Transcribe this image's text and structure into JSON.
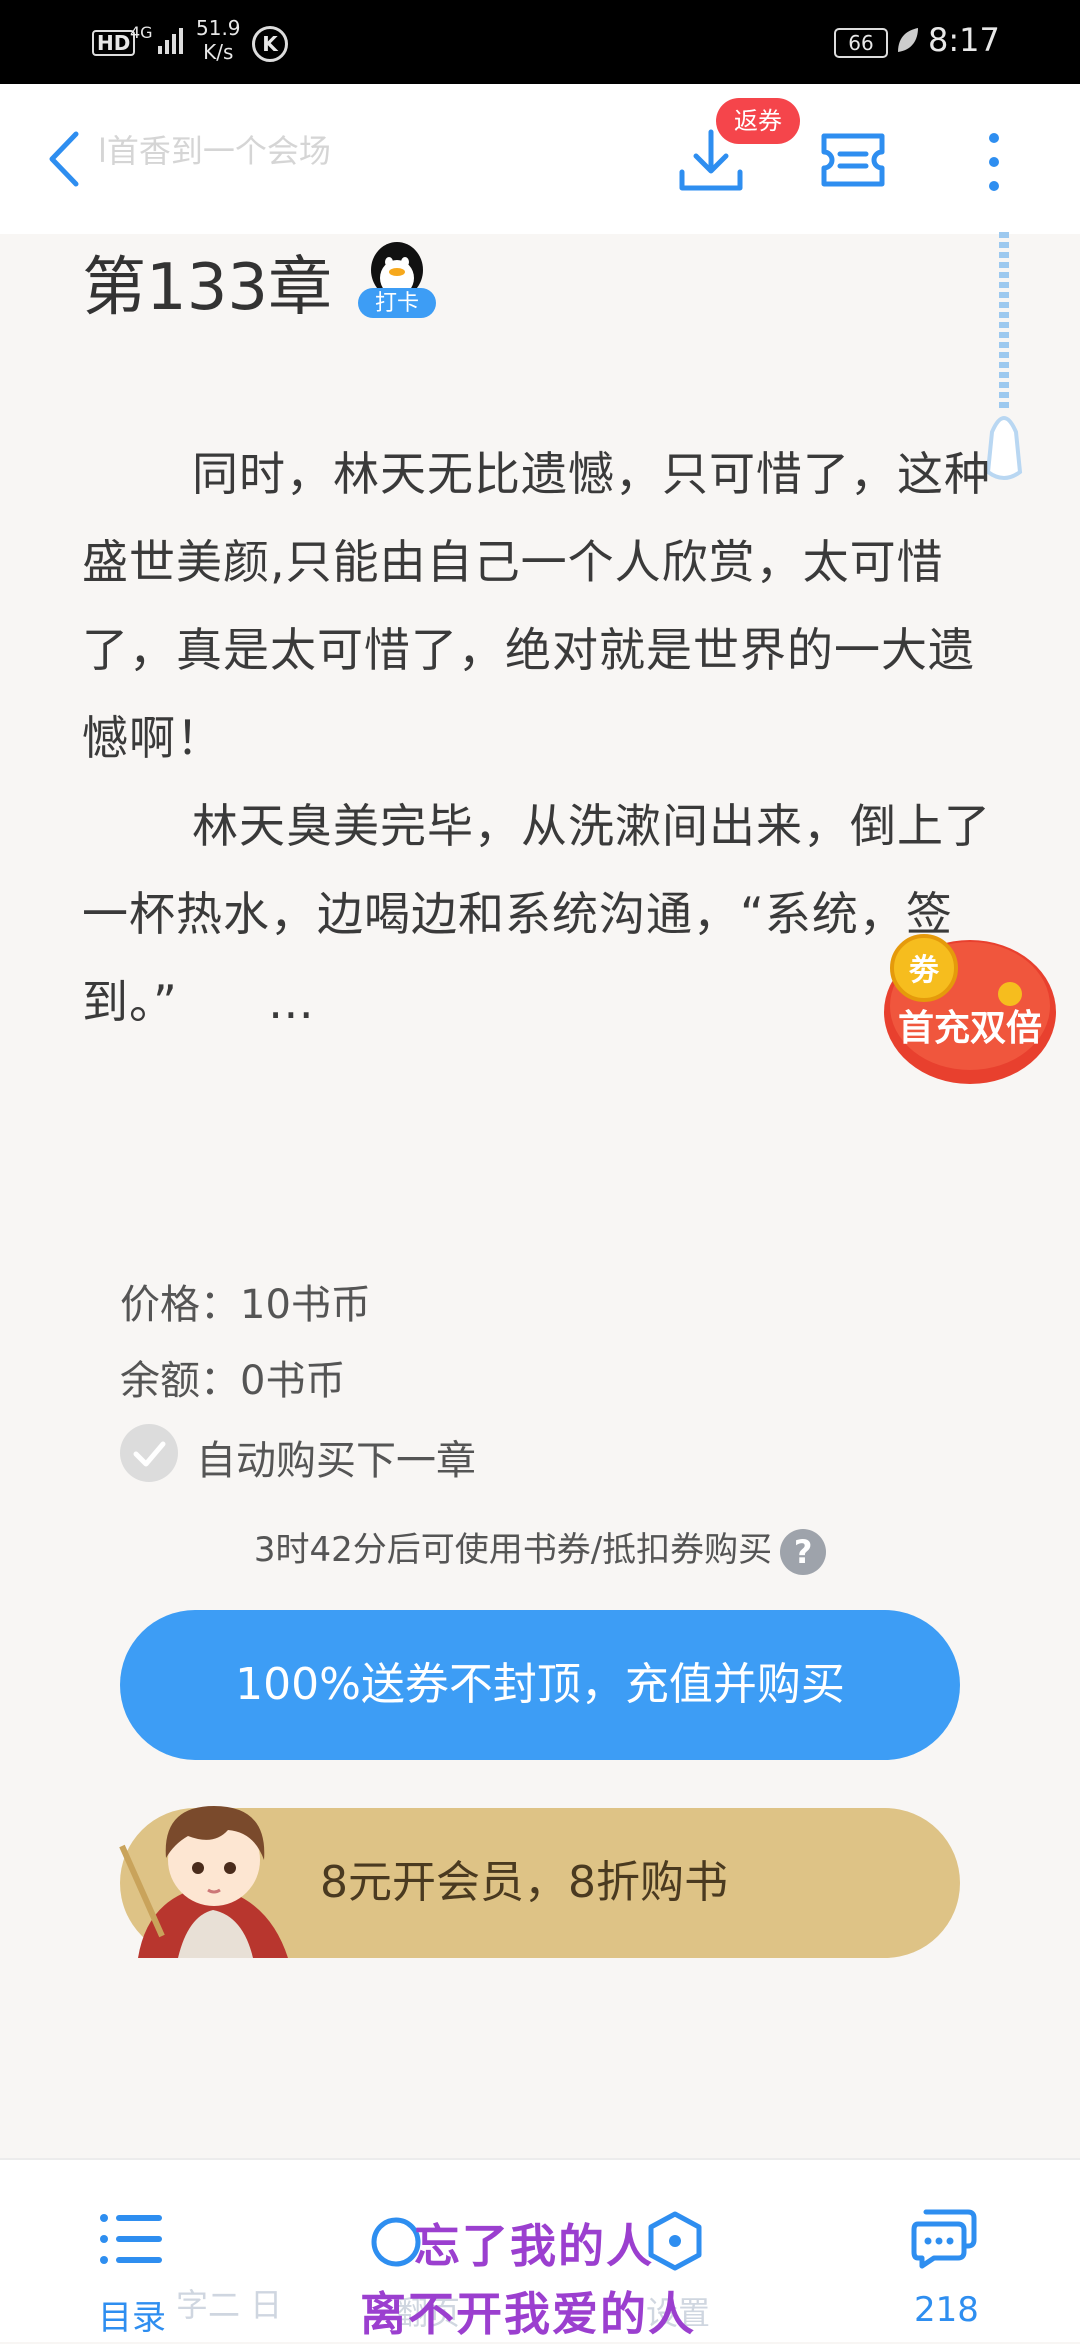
{
  "status_bar": {
    "hd": "HD",
    "network": "4G",
    "speed_value": "51.9",
    "speed_unit": "K/s",
    "k_icon": "K",
    "battery": "66",
    "time": "8:17"
  },
  "toolbar": {
    "faded_title": "l首香到一个会场",
    "badge": "返券"
  },
  "chapter": {
    "title": "第133章",
    "checkin": "打卡"
  },
  "text": {
    "p1": "同时，林天无比遗憾，只可惜了，这种盛世美颜,只能由自己一个人欣赏，太可惜了，真是太可惜了，绝对就是世界的一大遗憾啊！",
    "p2": "林天臭美完毕，从洗漱间出来，倒上了一杯热水，边喝边和系统沟通，“系统，签到。”",
    "ellipsis": "…"
  },
  "promo": {
    "coupon": "劵",
    "label": "首充双倍"
  },
  "purchase": {
    "price_label": "价格：",
    "price_value": "10书币",
    "balance_label": "余额：",
    "balance_value": "0书币",
    "auto_buy": "自动购买下一章",
    "tip": "3时42分后可使用书券/抵扣券购买",
    "help": "?",
    "recharge_button": "100%送券不封顶，充值并购买",
    "vip_button": "8元开会员，8折购书"
  },
  "bottom_nav": {
    "catalog": "目录",
    "faded_left": "字二 日",
    "faded_mid": "翻页",
    "faded_right": "设置",
    "comments_count": "218"
  },
  "overlay": {
    "line1": "忘了我的人",
    "line2": "离不开我爱的人"
  },
  "colors": {
    "accent_blue": "#3d9df5",
    "gold": "#dec386",
    "badge_red": "#f5454b",
    "overlay_purple": "#9b3fcf"
  }
}
